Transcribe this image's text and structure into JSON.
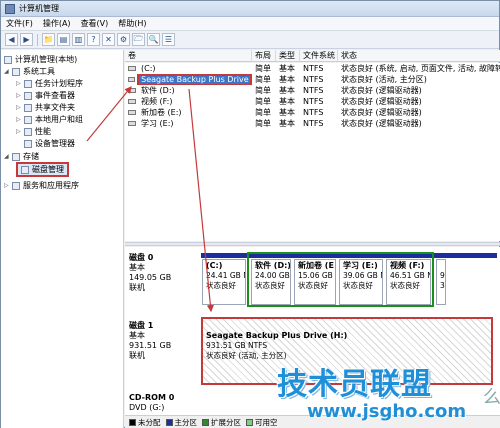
{
  "window": {
    "title": "计算机管理"
  },
  "menu": [
    "文件(F)",
    "操作(A)",
    "查看(V)",
    "帮助(H)"
  ],
  "toolbar": {
    "icons": [
      "back-icon",
      "forward-icon",
      "up-folder-icon",
      "console-tree-icon",
      "properties-icon",
      "help-icon",
      "delete-icon",
      "settings-icon",
      "folder-icon",
      "search-icon",
      "list-icon"
    ],
    "glyphs": [
      "◀",
      "▶",
      "📁",
      "▤",
      "▥",
      "?",
      "✕",
      "⚙",
      "🗁",
      "🔍",
      "☰"
    ]
  },
  "tree": {
    "root": "计算机管理(本地)",
    "system_tools": "系统工具",
    "task_scheduler": "任务计划程序",
    "event_viewer": "事件查看器",
    "shared_folders": "共享文件夹",
    "local_users": "本地用户和组",
    "performance": "性能",
    "device_manager": "设备管理器",
    "storage": "存储",
    "disk_management": "磁盘管理",
    "services": "服务和应用程序"
  },
  "volume_headers": [
    "卷",
    "布局",
    "类型",
    "文件系统",
    "状态"
  ],
  "volumes": [
    {
      "name": "(C:)",
      "layout": "简单",
      "type": "基本",
      "fs": "NTFS",
      "status": "状态良好 (系统, 启动, 页面文件, 活动, 故障转储, 主分区)"
    },
    {
      "name": "Seagate Backup Plus Drive (H:)",
      "layout": "简单",
      "type": "基本",
      "fs": "NTFS",
      "status": "状态良好 (活动, 主分区)"
    },
    {
      "name": "软件 (D:)",
      "layout": "简单",
      "type": "基本",
      "fs": "NTFS",
      "status": "状态良好 (逻辑驱动器)"
    },
    {
      "name": "视频 (F:)",
      "layout": "简单",
      "type": "基本",
      "fs": "NTFS",
      "status": "状态良好 (逻辑驱动器)"
    },
    {
      "name": "新加卷 (E:)",
      "layout": "简单",
      "type": "基本",
      "fs": "NTFS",
      "status": "状态良好 (逻辑驱动器)"
    },
    {
      "name": "学习 (E:)",
      "layout": "简单",
      "type": "基本",
      "fs": "NTFS",
      "status": "状态良好 (逻辑驱动器)"
    }
  ],
  "disk0": {
    "name": "磁盘 0",
    "type": "基本",
    "size": "149.05 GB",
    "state": "联机",
    "parts": [
      {
        "label": "(C:)",
        "size": "24.41 GB N",
        "status": "状态良好"
      },
      {
        "label": "软件 (D:)",
        "size": "24.00 GB",
        "status": "状态良好"
      },
      {
        "label": "新加卷 (E",
        "size": "15.06 GB",
        "status": "状态良好"
      },
      {
        "label": "学习 (E:)",
        "size": "39.06 GB N",
        "status": "状态良好"
      },
      {
        "label": "视频 (F:)",
        "size": "46.51 GB N",
        "status": "状态良好"
      },
      {
        "label": "",
        "size": "9",
        "status": "3"
      }
    ]
  },
  "disk1": {
    "name": "磁盘 1",
    "type": "基本",
    "size": "931.51 GB",
    "state": "联机",
    "part": {
      "label": "Seagate Backup Plus Drive (H:)",
      "size": "931.51 GB NTFS",
      "status": "状态良好 (活动, 主分区)"
    }
  },
  "cdrom": {
    "name": "CD-ROM 0",
    "type": "DVD (G:)"
  },
  "legend": [
    {
      "label": "未分配",
      "color": "#000000"
    },
    {
      "label": "主分区",
      "color": "#1b2e9e"
    },
    {
      "label": "扩展分区",
      "color": "#2e8b2e"
    },
    {
      "label": "可用空",
      "color": "#7ed07e"
    }
  ],
  "watermark": {
    "title": "技术员联盟",
    "url": "www.jsgho.com",
    "extra": "么"
  }
}
